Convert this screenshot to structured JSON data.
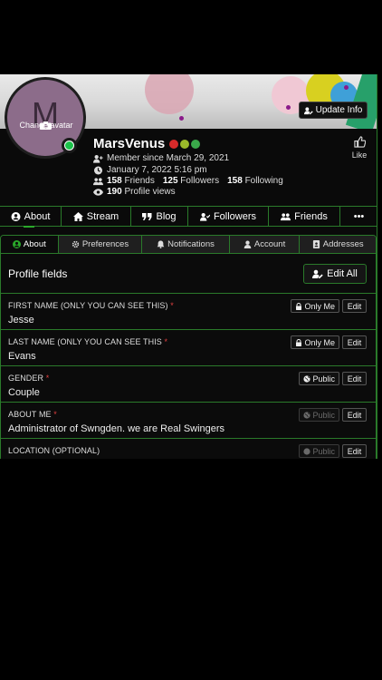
{
  "cover": {
    "update_label": "Update Info"
  },
  "avatar": {
    "letter": "M",
    "change_label": "Change avatar"
  },
  "user": {
    "name": "MarsVenus",
    "member_since": "Member since March 29, 2021",
    "last_seen": "January 7, 2022 5:16 pm",
    "friends_count": "158",
    "friends_label": "Friends",
    "followers_count": "125",
    "followers_label": "Followers",
    "following_count": "158",
    "following_label": "Following",
    "views_count": "190",
    "views_label": "Profile views",
    "badge_colors": [
      "#d82a2a",
      "#9ab82a",
      "#3aa84a"
    ]
  },
  "like_label": "Like",
  "main_tabs": [
    {
      "label": "About",
      "icon": "user-circle-icon"
    },
    {
      "label": "Stream",
      "icon": "home-icon"
    },
    {
      "label": "Blog",
      "icon": "quote-icon"
    },
    {
      "label": "Followers",
      "icon": "user-check-icon"
    },
    {
      "label": "Friends",
      "icon": "users-icon"
    },
    {
      "label": "•••",
      "icon": "more-icon"
    }
  ],
  "sub_tabs": [
    {
      "label": "About",
      "icon": "user-circle-icon"
    },
    {
      "label": "Preferences",
      "icon": "gear-icon"
    },
    {
      "label": "Notifications",
      "icon": "bell-icon"
    },
    {
      "label": "Account",
      "icon": "user-icon"
    },
    {
      "label": "Addresses",
      "icon": "address-book-icon"
    }
  ],
  "profile_fields": {
    "title": "Profile fields",
    "edit_all_label": "Edit All"
  },
  "fields": [
    {
      "label": "FIRST NAME (ONLY YOU CAN SEE THIS)",
      "req": "*",
      "value": "Jesse",
      "privacy": "Only Me",
      "edit": "Edit"
    },
    {
      "label": "LAST NAME (ONLY YOU CAN SEE THIS",
      "req": "*",
      "value": "Evans",
      "privacy": "Only Me",
      "edit": "Edit"
    },
    {
      "label": "GENDER",
      "req": "*",
      "value": "Couple",
      "privacy": "Public",
      "edit": "Edit"
    },
    {
      "label": "ABOUT ME",
      "req": "*",
      "value": "Administrator of Swngden. we are Real Swingers",
      "privacy": "Public",
      "edit": "Edit"
    },
    {
      "label": "LOCATION (OPTIONAL)",
      "req": "",
      "value": "",
      "privacy": "Public",
      "edit": "Edit"
    }
  ],
  "colors": {
    "accent_green": "#2a7a2a",
    "online": "#1cc24a",
    "required": "#e04040"
  }
}
